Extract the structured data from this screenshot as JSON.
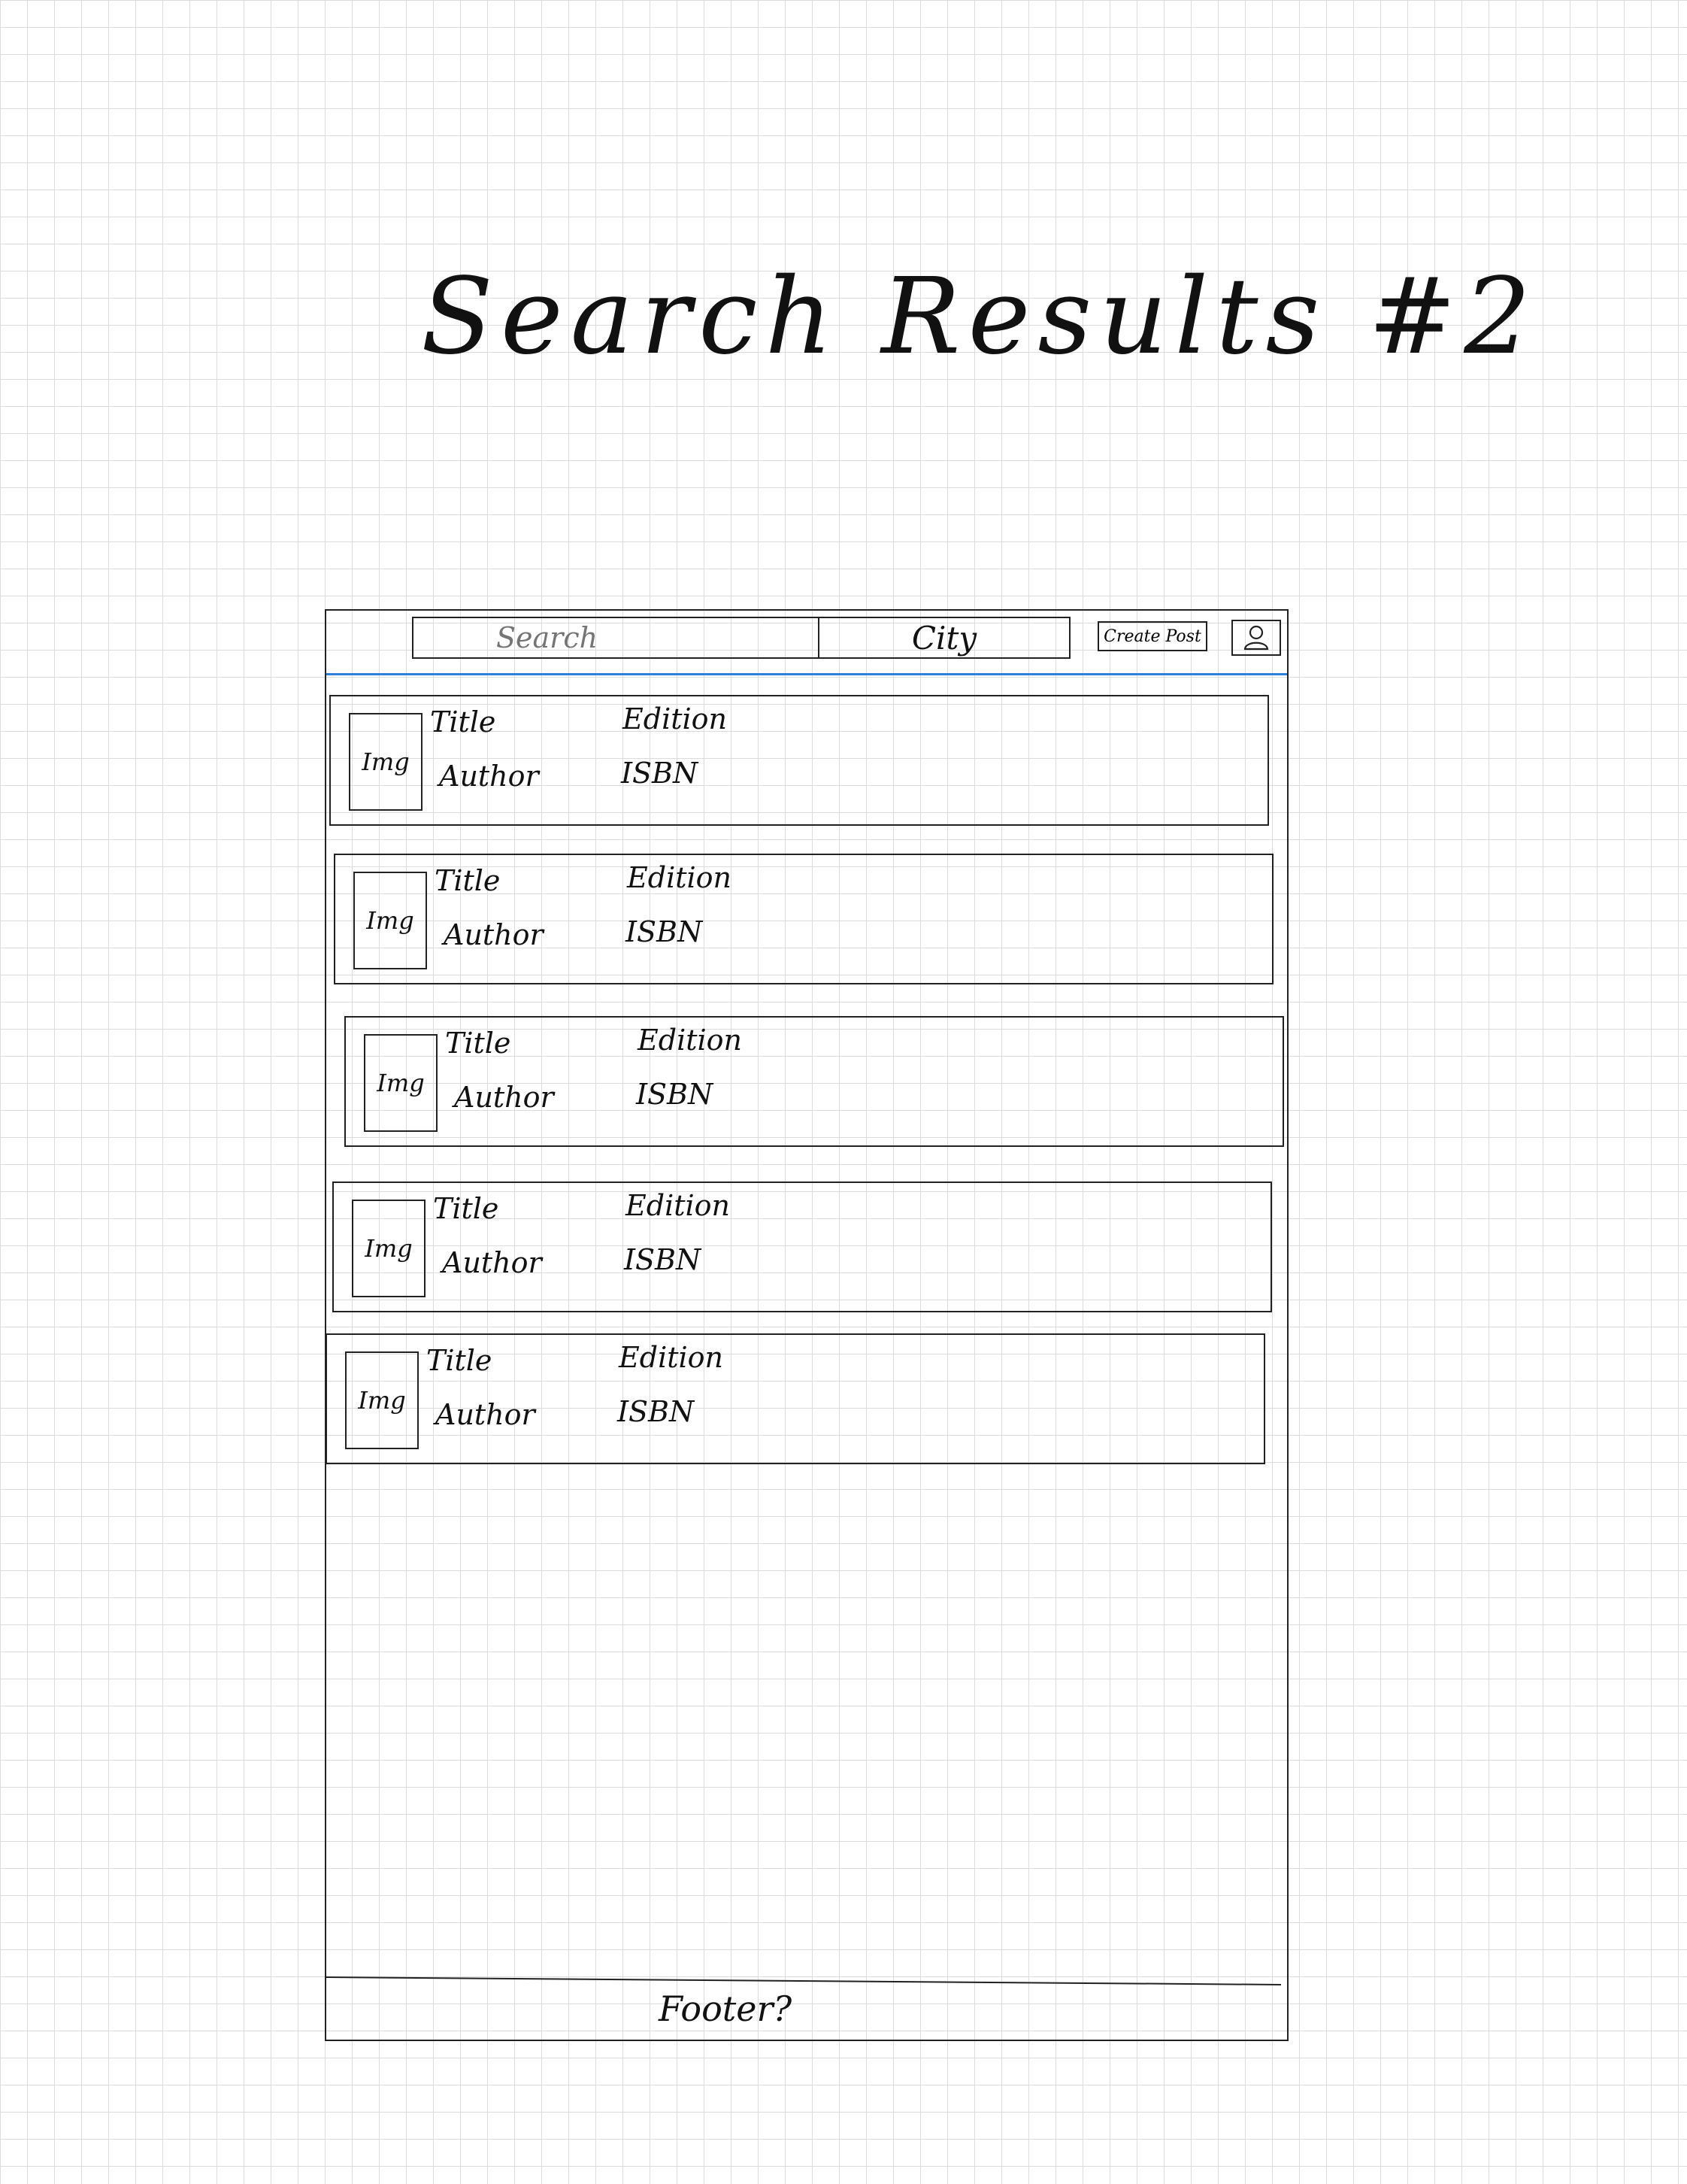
{
  "page_title": "Search Results #2",
  "header": {
    "search_placeholder": "Search",
    "city_label": "City",
    "create_post_label": "Create Post",
    "profile_icon": "user-icon"
  },
  "results": [
    {
      "image_label": "Img",
      "title_label": "Title",
      "author_label": "Author",
      "edition_label": "Edition",
      "isbn_label": "ISBN"
    },
    {
      "image_label": "Img",
      "title_label": "Title",
      "author_label": "Author",
      "edition_label": "Edition",
      "isbn_label": "ISBN"
    },
    {
      "image_label": "Img",
      "title_label": "Title",
      "author_label": "Author",
      "edition_label": "Edition",
      "isbn_label": "ISBN"
    },
    {
      "image_label": "Img",
      "title_label": "Title",
      "author_label": "Author",
      "edition_label": "Edition",
      "isbn_label": "ISBN"
    },
    {
      "image_label": "Img",
      "title_label": "Title",
      "author_label": "Author",
      "edition_label": "Edition",
      "isbn_label": "ISBN"
    }
  ],
  "footer": {
    "label": "Footer?"
  },
  "colors": {
    "ink": "#222222",
    "header_divider": "#2f80d8",
    "grid": "#dcdcdc"
  }
}
